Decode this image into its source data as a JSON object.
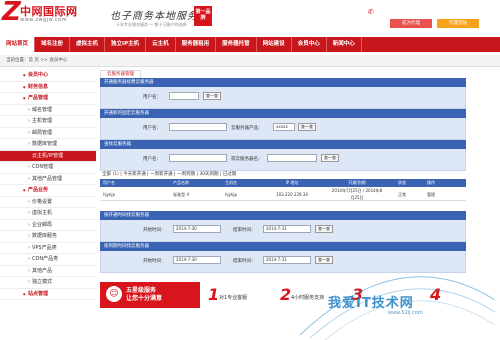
{
  "header": {
    "logo_letter": "Z",
    "brand": "中网国际网",
    "domain": "www.zwgjw.com",
    "slogan": "也子商务本地服务",
    "slogan_sub": "十年专业域名服务 — 数十万客户的选择",
    "badge": "第一品牌",
    "phone_icon": "phone-icon",
    "agent_button": "成为代理",
    "login_button": "代理登陆"
  },
  "nav": {
    "items": [
      "网站首页",
      "域名注册",
      "虚拟主机",
      "独立IP主机",
      "云主机",
      "服务器租用",
      "服务器托管",
      "网站建设",
      "会员中心",
      "新闻中心"
    ]
  },
  "breadcrumb": "当前位置：首 页 >> 会员中心",
  "sidebar": {
    "items": [
      {
        "label": "会员中心",
        "kind": "head"
      },
      {
        "label": "财务信息",
        "kind": "head"
      },
      {
        "label": "产品管理",
        "kind": "head"
      },
      {
        "label": "域名管理",
        "kind": "sub"
      },
      {
        "label": "主机管理",
        "kind": "sub"
      },
      {
        "label": "邮局管理",
        "kind": "sub"
      },
      {
        "label": "数据库管理",
        "kind": "sub"
      },
      {
        "label": "云主机/IP管理",
        "kind": "sub-active"
      },
      {
        "label": "CDN管理",
        "kind": "sub"
      },
      {
        "label": "其他产品管理",
        "kind": "sub"
      },
      {
        "label": "产品业务",
        "kind": "head"
      },
      {
        "label": "价格设置",
        "kind": "sub"
      },
      {
        "label": "虚拟主机",
        "kind": "sub"
      },
      {
        "label": "企业邮局",
        "kind": "sub"
      },
      {
        "label": "数据库服务",
        "kind": "sub"
      },
      {
        "label": "VPS产品类",
        "kind": "sub"
      },
      {
        "label": "CDN产品类",
        "kind": "sub"
      },
      {
        "label": "其他产品",
        "kind": "sub"
      },
      {
        "label": "独立模式",
        "kind": "sub"
      },
      {
        "label": "站点管理",
        "kind": "head"
      }
    ]
  },
  "main": {
    "tab_title": "云服务器管理",
    "section1": {
      "title": "开通服务器续费云服务器",
      "user_label": "用户名：",
      "query_button": "查一查"
    },
    "section2": {
      "title": "开通新的固定云服务器",
      "user_label": "用户名：",
      "server_label": "云服务器产品：",
      "select_value": "xxxxx",
      "query_button": "查一查"
    },
    "section3": {
      "title": "查找云服务器",
      "user_label": "用户名：",
      "server_label": "或云服务器名：",
      "query_button": "查一查"
    },
    "filter": {
      "prefix": "全部",
      "count": "(1)",
      "rest": "| 今天新开通 | 一周新开通 | 一周到期 | 30天到期 | 已过期"
    },
    "table": {
      "headers": [
        "用户名",
        "产品名称",
        "主机名",
        "IP 地址",
        "开通/到期",
        "状态",
        "操作"
      ],
      "rows": [
        {
          "user": "hjykjp",
          "product": "标准型 II",
          "host": "hjykjp",
          "ip": "103.220.129.34",
          "dates": "2014年7月25日 / 2014年8月25日",
          "status": "正常",
          "action": "管理"
        }
      ]
    },
    "section4": {
      "title": "按开通时间找云服务器",
      "start_label": "开始时间：",
      "start_value": "2014-7-30",
      "end_label": "结束时间：",
      "end_value": "2014-7-31",
      "query_button": "查一查"
    },
    "section5": {
      "title": "按到期时间找云服务器",
      "start_label": "开始时间：",
      "start_value": "2014-7-30",
      "end_label": "结束时间：",
      "end_value": "2014-7-31",
      "query_button": "查一查"
    }
  },
  "banner": {
    "red_line1": "五星级服务",
    "red_line2": "让您十分满意",
    "features": [
      {
        "num": "1",
        "text": "对1专业客服"
      },
      {
        "num": "2",
        "text": "4小时服务支持"
      },
      {
        "num": "3",
        "text": ""
      },
      {
        "num": "4",
        "text": ""
      }
    ]
  },
  "watermark": {
    "text": "我爱IT技术网",
    "url": "www.52ij.com"
  },
  "colors": {
    "brand_red": "#c8161d",
    "table_blue": "#3a63b4",
    "panel_blue": "#dde7f5",
    "agent_btn": "#e8514d",
    "login_btn": "#f7a21b"
  }
}
